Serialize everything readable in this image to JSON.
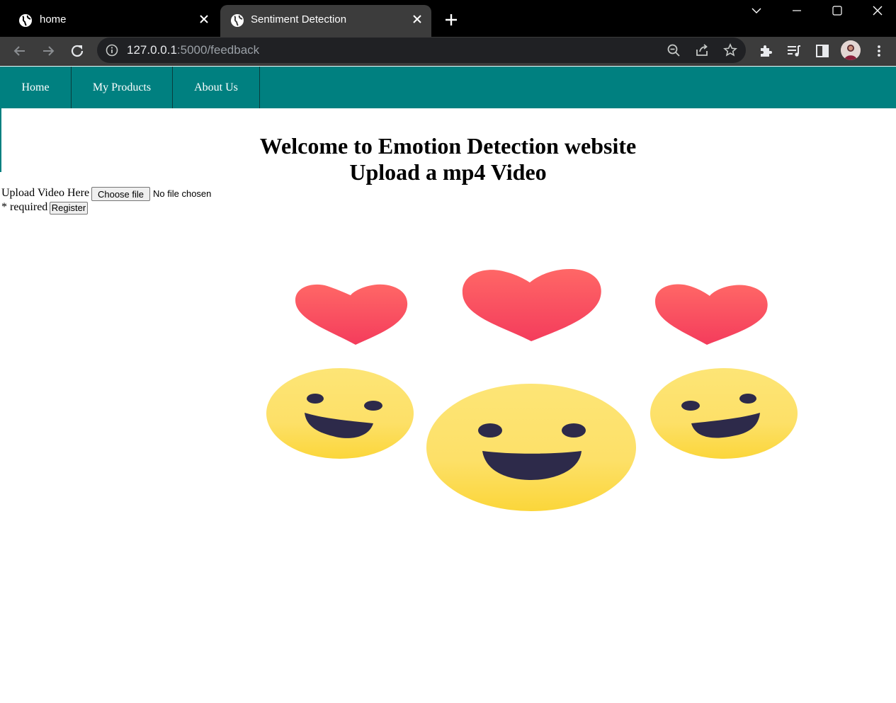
{
  "browser": {
    "tabs": [
      {
        "title": "home",
        "active": false
      },
      {
        "title": "Sentiment Detection",
        "active": true
      }
    ],
    "url": {
      "host": "127.0.0.1",
      "path": ":5000/feedback"
    },
    "icons": [
      "globe-icon",
      "close-icon",
      "plus-icon",
      "chevron-down-icon",
      "minimize-icon",
      "maximize-icon",
      "window-close-icon",
      "back-icon",
      "forward-icon",
      "reload-icon",
      "info-icon",
      "zoom-icon",
      "share-icon",
      "star-icon",
      "extensions-icon",
      "reading-list-icon",
      "side-panel-icon",
      "profile-avatar",
      "menu-icon"
    ]
  },
  "navbar": {
    "background": "#008080",
    "items": [
      {
        "label": "Home"
      },
      {
        "label": "My Products"
      },
      {
        "label": "About Us"
      }
    ]
  },
  "main": {
    "heading_line1": "Welcome to Emotion Detection website",
    "heading_line2": "Upload a mp4 Video",
    "upload_label": "Upload Video Here",
    "choose_file_label": "Choose file",
    "file_status": "No file chosen",
    "required_note": "* required",
    "register_label": "Register"
  },
  "illustration": {
    "heart_color": "#f7475f",
    "face_color": "#fde068",
    "mouth_color": "#2d2a4a"
  }
}
